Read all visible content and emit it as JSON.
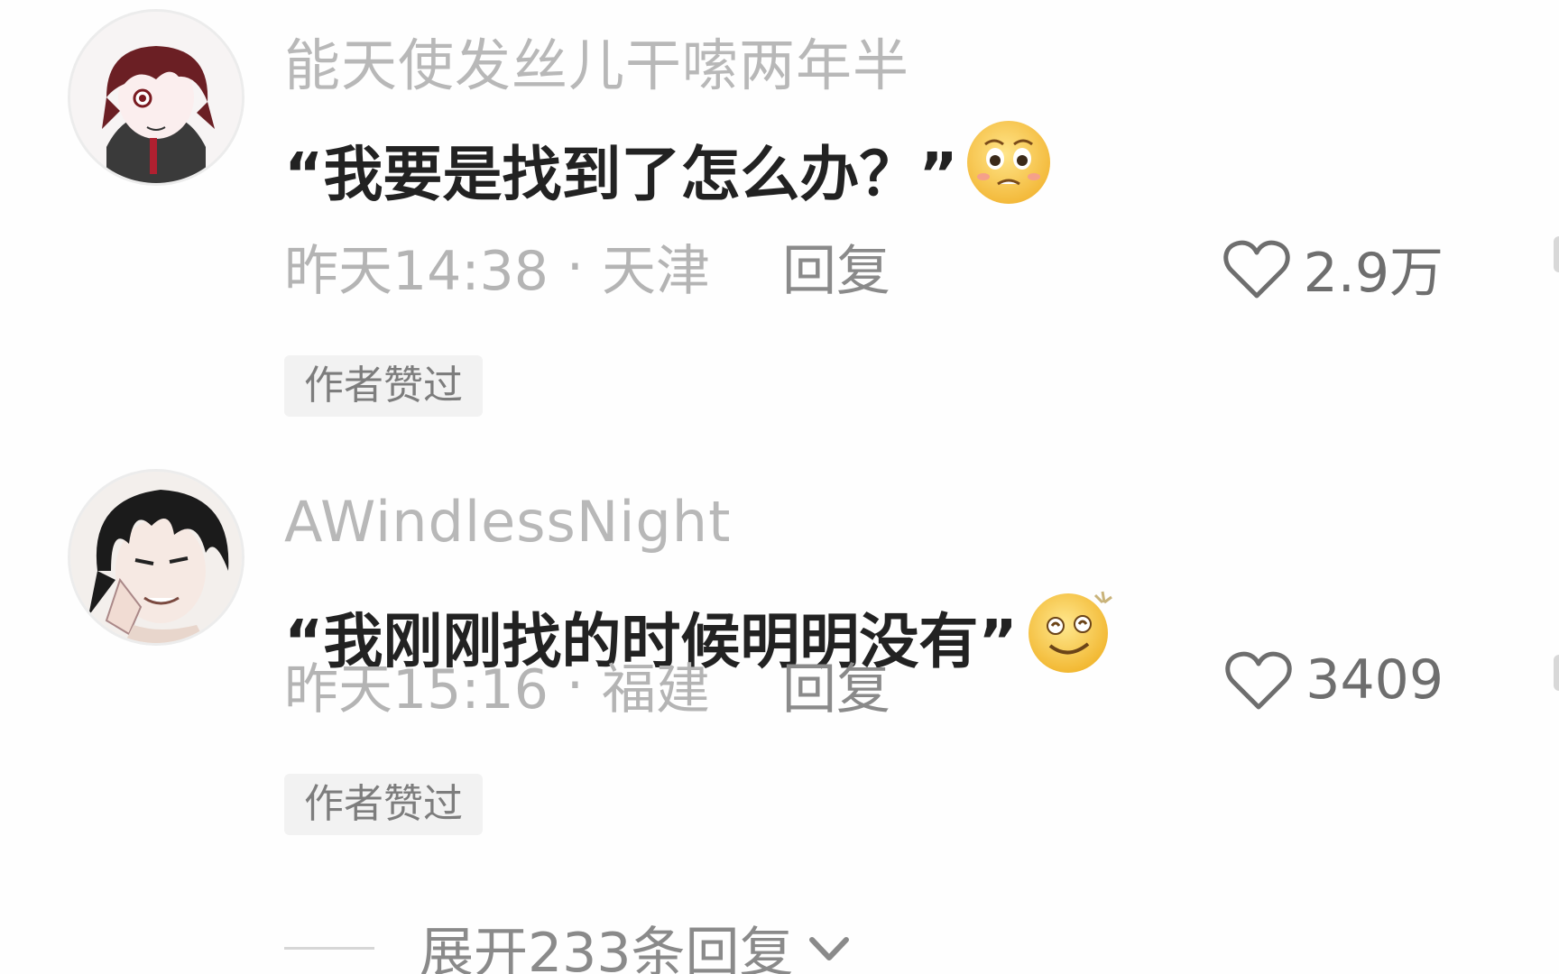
{
  "comments": [
    {
      "username": "能天使发丝儿干嗦两年半",
      "content": "“我要是找到了怎么办？”",
      "emoji": "pleading-face-emoji",
      "time": "昨天14:38",
      "separator": "·",
      "location": "天津",
      "reply_label": "回复",
      "like_count": "2.9万",
      "badge": "作者赞过"
    },
    {
      "username": "AWindlessNight",
      "content": "“我刚刚找的时候明明没有”",
      "emoji": "dizzy-smile-emoji",
      "time": "昨天15:16",
      "separator": "·",
      "location": "福建",
      "reply_label": "回复",
      "like_count": "3409",
      "badge": "作者赞过"
    }
  ],
  "expand_replies": {
    "label": "展开233条回复",
    "icon": "chevron-down-icon"
  },
  "colors": {
    "username": "#b8b8b8",
    "content": "#222222",
    "meta": "#b4b4b4",
    "badge_bg": "#f2f2f2",
    "emoji_yellow": "#f7c948"
  }
}
